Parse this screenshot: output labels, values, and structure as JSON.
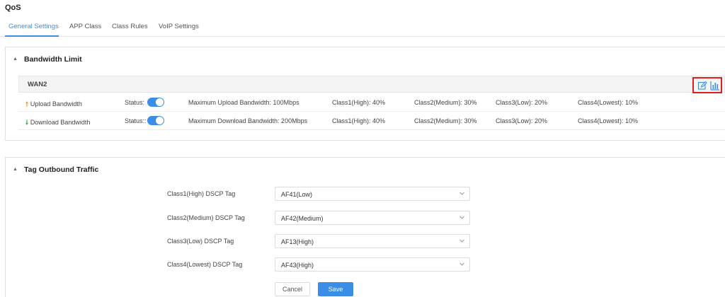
{
  "page": {
    "title": "QoS"
  },
  "tabs": [
    {
      "label": "General Settings",
      "active": true
    },
    {
      "label": "APP Class",
      "active": false
    },
    {
      "label": "Class Rules",
      "active": false
    },
    {
      "label": "VoIP Settings",
      "active": false
    }
  ],
  "bandwidth": {
    "header": "Bandwidth Limit",
    "wan_title": "WAN2",
    "actions": {
      "edit_icon": "edit-icon",
      "chart_icon": "bar-chart-icon"
    },
    "rows": [
      {
        "arrow": "🠕",
        "label": "Upload Bandwidth",
        "status_label": "Status:",
        "status_on": true,
        "max": "Maximum Upload Bandwidth: 100Mbps",
        "class1": "Class1(High): 40%",
        "class2": "Class2(Medium): 30%",
        "class3": "Class3(Low): 20%",
        "class4": "Class4(Lowest): 10%"
      },
      {
        "arrow": "🠗",
        "label": "Download Bandwidth",
        "status_label": "Status::",
        "status_on": true,
        "max": "Maximum Download Bandwidth: 200Mbps",
        "class1": "Class1(High): 40%",
        "class2": "Class2(Medium): 30%",
        "class3": "Class3(Low): 20%",
        "class4": "Class4(Lowest): 10%"
      }
    ]
  },
  "tag_outbound": {
    "header": "Tag Outbound Traffic",
    "fields": [
      {
        "label": "Class1(High) DSCP Tag",
        "value": "AF41(Low)"
      },
      {
        "label": "Class2(Medium) DSCP Tag",
        "value": "AF42(Medium)"
      },
      {
        "label": "Class3(Low) DSCP Tag",
        "value": "AF13(High)"
      },
      {
        "label": "Class4(Lowest) DSCP Tag",
        "value": "AF43(High)"
      }
    ],
    "cancel_label": "Cancel",
    "save_label": "Save"
  },
  "colors": {
    "accent": "#3a8ee6",
    "highlight_box": "#e02020",
    "upload_arrow": "#f0901e",
    "download_arrow": "#2ea44f"
  }
}
